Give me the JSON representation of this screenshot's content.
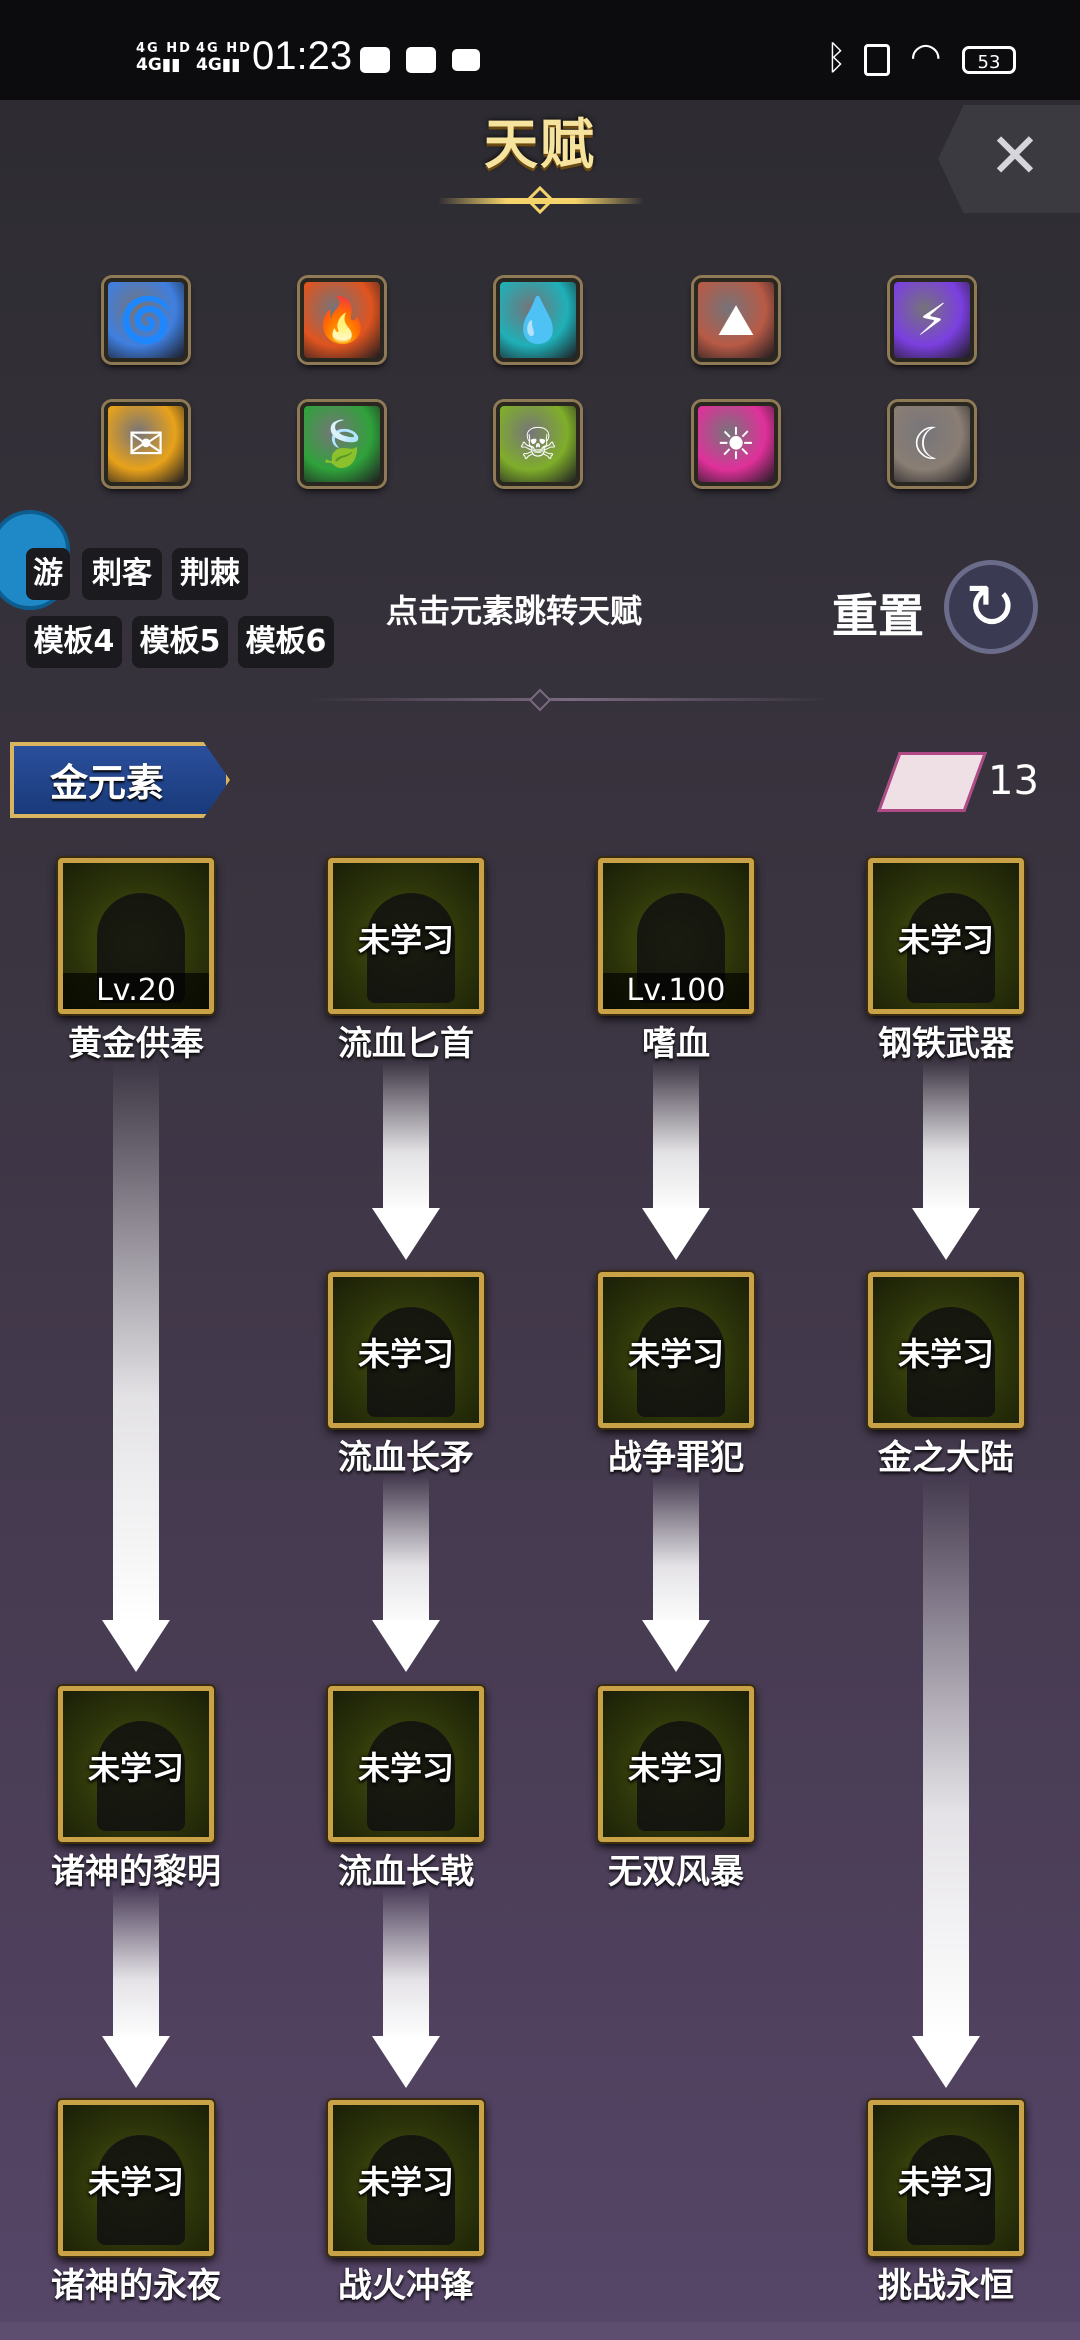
{
  "status_bar": {
    "net1": "4G HD",
    "net1_bars": "4G",
    "net2": "4G HD",
    "net2_bars": "4G",
    "time": "01:23",
    "battery": "53"
  },
  "header": {
    "title": "天赋",
    "close_icon": "close-icon"
  },
  "elements": [
    {
      "name": "wind",
      "icon": "tornado-icon",
      "color": "#3f7fe0",
      "glyph": "🌀"
    },
    {
      "name": "fire",
      "icon": "flame-icon",
      "color": "#e0541f",
      "glyph": "🔥"
    },
    {
      "name": "water",
      "icon": "water-drop-icon",
      "color": "#1fb0b8",
      "glyph": "💧"
    },
    {
      "name": "earth",
      "icon": "mountain-icon",
      "color": "#b85a46",
      "glyph": "⛰"
    },
    {
      "name": "thunder",
      "icon": "lightning-icon",
      "color": "#7b3fe0",
      "glyph": "⚡"
    },
    {
      "name": "gold",
      "icon": "gold-element-icon",
      "color": "#e8a21a",
      "glyph": "✉"
    },
    {
      "name": "wood",
      "icon": "leaf-icon",
      "color": "#2fa23a",
      "glyph": "🍃"
    },
    {
      "name": "poison",
      "icon": "skull-icon",
      "color": "#7fae2a",
      "glyph": "☠"
    },
    {
      "name": "light",
      "icon": "sun-icon",
      "color": "#e0309a",
      "glyph": "☀"
    },
    {
      "name": "dark",
      "icon": "moon-icon",
      "color": "#8a7e74",
      "glyph": "☾"
    }
  ],
  "templates": {
    "row1": [
      "游",
      "刺客",
      "荆棘"
    ],
    "row2": [
      "模板4",
      "模板5",
      "模板6"
    ]
  },
  "hint": "点击元素跳转天赋",
  "reset_label": "重置",
  "banner_label": "金元素",
  "talent_points": "13",
  "nodes": {
    "n1": {
      "name": "黄金供奉",
      "state": "",
      "level": "Lv.20"
    },
    "n2": {
      "name": "流血匕首",
      "state": "未学习",
      "level": ""
    },
    "n3": {
      "name": "嗜血",
      "state": "",
      "level": "Lv.100"
    },
    "n4": {
      "name": "钢铁武器",
      "state": "未学习",
      "level": ""
    },
    "n5": {
      "name": "流血长矛",
      "state": "未学习",
      "level": ""
    },
    "n6": {
      "name": "战争罪犯",
      "state": "未学习",
      "level": ""
    },
    "n7": {
      "name": "金之大陆",
      "state": "未学习",
      "level": ""
    },
    "n8": {
      "name": "诸神的黎明",
      "state": "未学习",
      "level": ""
    },
    "n9": {
      "name": "流血长戟",
      "state": "未学习",
      "level": ""
    },
    "n10": {
      "name": "无双风暴",
      "state": "未学习",
      "level": ""
    },
    "n11": {
      "name": "诸神的永夜",
      "state": "未学习",
      "level": ""
    },
    "n12": {
      "name": "战火冲锋",
      "state": "未学习",
      "level": ""
    },
    "n13": {
      "name": "挑战永恒",
      "state": "未学习",
      "level": ""
    }
  }
}
